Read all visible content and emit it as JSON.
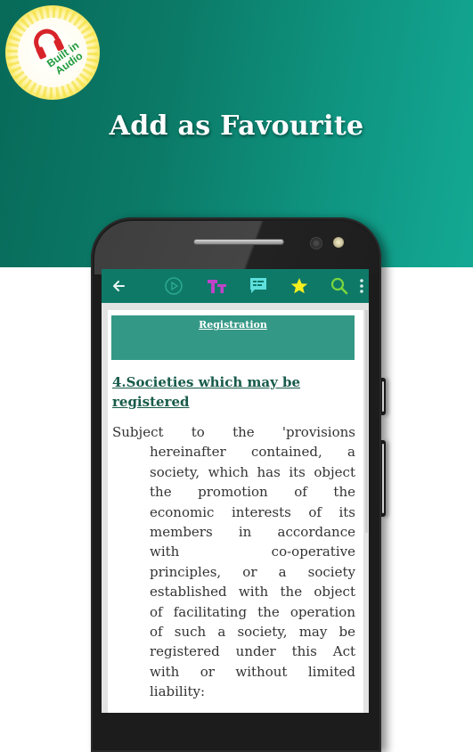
{
  "badge": {
    "icon": "headphones-icon",
    "line1": "Built in",
    "line2": "Audio",
    "colors": {
      "icon": "#d8232a",
      "text": "#1e9a3c",
      "burst": "#f2e24a"
    }
  },
  "headline": "Add as Favourite",
  "toolbar": {
    "items": [
      {
        "name": "back",
        "icon": "arrow-left-icon",
        "glyph": "←",
        "color": "#e8f4f1"
      },
      {
        "name": "play",
        "icon": "play-circle-icon",
        "glyph": "▶",
        "color": "#2aa892"
      },
      {
        "name": "text-size",
        "icon": "text-size-icon",
        "glyph": "Tт",
        "color": "#c043c9"
      },
      {
        "name": "notes",
        "icon": "comment-icon",
        "glyph": "",
        "color": "#5fe0dd"
      },
      {
        "name": "favourite",
        "icon": "star-icon",
        "glyph": "★",
        "color": "#f5f01e"
      },
      {
        "name": "search",
        "icon": "search-icon",
        "glyph": "",
        "color": "#7ad63e"
      },
      {
        "name": "more",
        "icon": "more-vertical-icon",
        "glyph": "⋮",
        "color": "#d6efe9"
      }
    ]
  },
  "content": {
    "section_title": "Registration",
    "heading_line1": "4.Societies which may be",
    "heading_line2": "registered",
    "body_lines": [
      "Subject to the 'provisions",
      "hereinafter contained, a",
      "society, which has its object",
      "the promotion of the",
      "economic interests of its",
      "members in accordance",
      "with co-operative",
      "principles, or a society",
      "established with the object",
      "of facilitating the operation",
      "of such a society, may be",
      "registered under this Act",
      "with or without limited",
      "liability:"
    ]
  },
  "colors": {
    "hero_dark": "#086a59",
    "hero_light": "#13a994",
    "toolbar": "#0f7968",
    "section_box": "#349886",
    "heading": "#185b4a"
  }
}
